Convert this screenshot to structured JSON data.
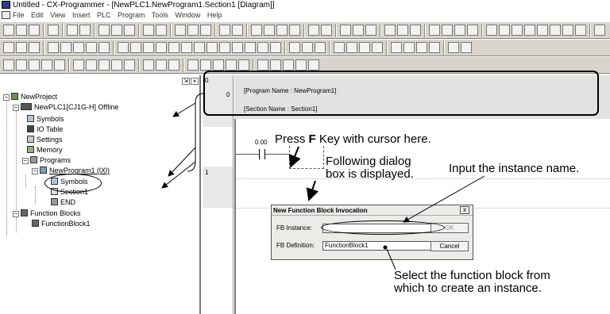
{
  "window": {
    "title": "Untitled - CX-Programmer - [NewPLC1.NewProgram1.Section1 [Diagram]]"
  },
  "menu": {
    "items": [
      "File",
      "Edit",
      "View",
      "Insert",
      "PLC",
      "Program",
      "Tools",
      "Window",
      "Help"
    ]
  },
  "tree": {
    "project": "NewProject",
    "plc": "NewPLC1[CJ1G-H] Offline",
    "symbols": "Symbols",
    "io_table": "IO Table",
    "settings": "Settings",
    "memory": "Memory",
    "programs": "Programs",
    "program1": "NewProgram1 (00)",
    "program_symbols": "Symbols",
    "section1": "Section1",
    "end": "END",
    "function_blocks": "Function Blocks",
    "function_block1": "FunctionBlock1"
  },
  "diagram": {
    "rung0_number": "0",
    "rung0_inner_number": "0",
    "program_name_comment": "[Program Name : NewProgram1]",
    "section_comment": "[Section Name : Section1]",
    "contact_address": "0.00",
    "rung1_number": "1"
  },
  "dialog": {
    "title": "New Function Block Invocation",
    "close_label": "x",
    "instance_label": "FB Instance:",
    "instance_value": "",
    "definition_label": "FB Definition:",
    "definition_value": "FunctionBlock1",
    "ok_label": "OK",
    "cancel_label": "Cancel"
  },
  "annotations": {
    "press_prefix": "Press ",
    "press_key": "F",
    "press_suffix": " Key with cursor here.",
    "following_line1": "Following dialog",
    "following_line2": "box is displayed.",
    "input_instance": "Input the instance name.",
    "select_line1": "Select the function block from",
    "select_line2": "which to create an instance."
  }
}
